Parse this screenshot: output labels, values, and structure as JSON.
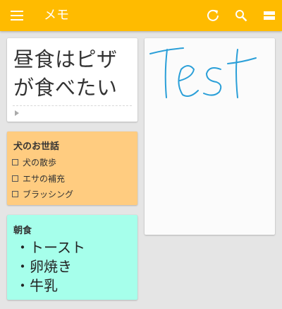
{
  "colors": {
    "appbar": "#ffbb00",
    "background": "#e5e5e5",
    "note_orange": "#ffcc80",
    "note_teal": "#a6ffeb",
    "ink_blue": "#2a9fd8"
  },
  "appbar": {
    "title": "メモ",
    "icons": [
      "menu-icon",
      "refresh-icon",
      "search-icon",
      "view-toggle-icon"
    ]
  },
  "notes": {
    "lunch": {
      "text_line1": "昼食はピザ",
      "text_line2": "が食べたい",
      "footer_icon": "play-icon"
    },
    "dog": {
      "title": "犬のお世話",
      "items": [
        {
          "label": "犬の散歩",
          "checked": false
        },
        {
          "label": "エサの補充",
          "checked": false
        },
        {
          "label": "ブラッシング",
          "checked": false
        }
      ]
    },
    "breakfast": {
      "title": "朝食",
      "items": [
        "・トースト",
        "・卵焼き",
        "・牛乳"
      ]
    },
    "drawing": {
      "handwriting": "Test"
    }
  }
}
